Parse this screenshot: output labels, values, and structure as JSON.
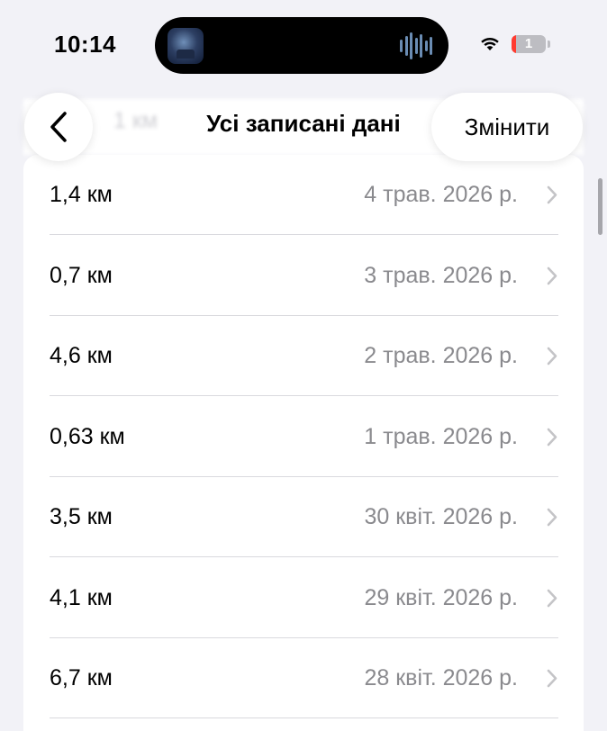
{
  "status_bar": {
    "time": "10:14",
    "battery_level": "1",
    "battery_fraction": 0.05,
    "battery_color": "#ff3b30"
  },
  "nav": {
    "back_icon": "chevron-left-icon",
    "title": "Усі записані дані",
    "edit_label": "Змінити"
  },
  "records": [
    {
      "value": "1,4 км",
      "date": "4 трав. 2026 р."
    },
    {
      "value": "0,7 км",
      "date": "3 трав. 2026 р."
    },
    {
      "value": "4,6 км",
      "date": "2 трав. 2026 р."
    },
    {
      "value": "0,63 км",
      "date": "1 трав. 2026 р."
    },
    {
      "value": "3,5 км",
      "date": "30 квіт. 2026 р."
    },
    {
      "value": "4,1 км",
      "date": "29 квіт. 2026 р."
    },
    {
      "value": "6,7 км",
      "date": "28 квіт. 2026 р."
    }
  ],
  "colors": {
    "background": "#f2f2f7",
    "secondary_text": "#8a8a8e",
    "chevron": "#c4c4c7"
  }
}
